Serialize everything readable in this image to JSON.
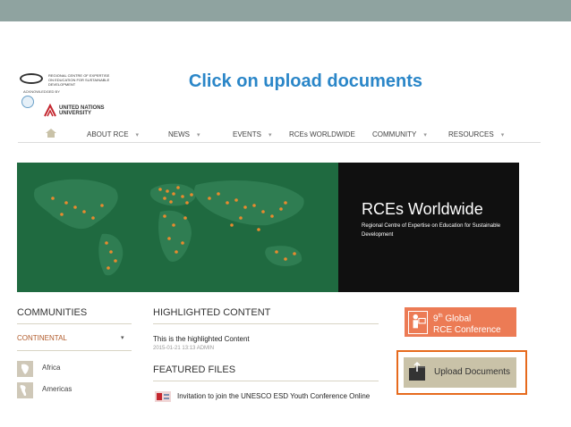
{
  "slide": {
    "title": "Click on upload documents"
  },
  "logos": {
    "rce_text": "REGIONAL CENTRE OF EXPERTISE ON EDUCATION FOR SUSTAINABLE DEVELOPMENT",
    "acknowledged": "ACKNOWLEDGED BY",
    "unu_text": "UNITED NATIONS UNIVERSITY"
  },
  "nav": {
    "items": [
      {
        "label": "ABOUT RCE",
        "has_caret": true
      },
      {
        "label": "NEWS",
        "has_caret": true
      },
      {
        "label": "EVENTS",
        "has_caret": true
      },
      {
        "label": "RCEs WORLDWIDE",
        "has_caret": false
      },
      {
        "label": "COMMUNITY",
        "has_caret": true
      },
      {
        "label": "RESOURCES",
        "has_caret": true
      }
    ],
    "caret": "▾"
  },
  "banner": {
    "title": "RCEs Worldwide",
    "subtitle": "Regional Centre of Expertise on Education for Sustainable Development"
  },
  "communities": {
    "heading": "COMMUNITIES",
    "filter": "CONTINENTAL",
    "caret": "▾",
    "regions": [
      "Africa",
      "Americas"
    ]
  },
  "highlighted": {
    "heading": "HIGHLIGHTED CONTENT",
    "text": "This is the highlighted Content",
    "date": "2015-01-21 13:13",
    "author": "ADMIN"
  },
  "featured": {
    "heading": "FEATURED FILES",
    "file": "Invitation to join the UNESCO ESD Youth Conference Online"
  },
  "sidebar": {
    "conference_pre": "9",
    "conference_sup": "th",
    "conference_line1": " Global",
    "conference_line2": "RCE Conference",
    "upload_label": "Upload Documents"
  },
  "colors": {
    "title_blue": "#2a86c8",
    "map_green": "#1f6a40",
    "dot_orange": "#e88a2e",
    "conference_orange": "#ec7b55",
    "upload_outline": "#e66a1d"
  }
}
